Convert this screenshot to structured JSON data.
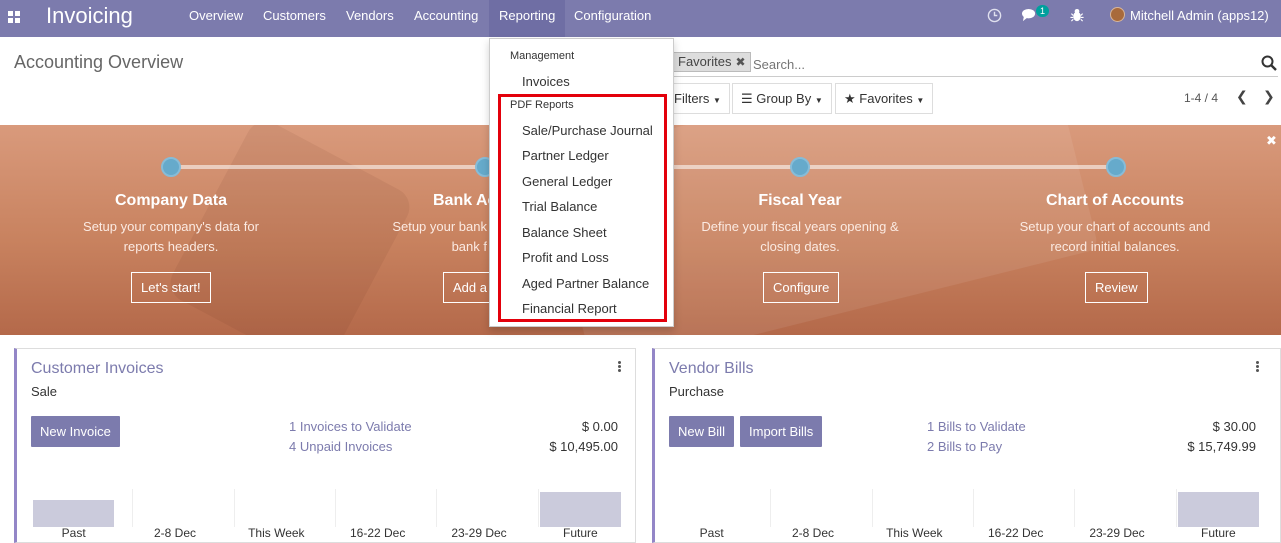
{
  "navbar": {
    "app_name": "Invoicing",
    "menus": [
      "Overview",
      "Customers",
      "Vendors",
      "Accounting",
      "Reporting",
      "Configuration"
    ],
    "active_menu": "Reporting",
    "messages_badge": "1",
    "user": "Mitchell Admin (apps12)"
  },
  "control_panel": {
    "title": "Accounting Overview",
    "facet": "Favorites",
    "search_placeholder": "Search...",
    "filters": "Filters",
    "group_by": "Group By",
    "favorites": "Favorites",
    "pager": "1-4 / 4"
  },
  "dropdown": {
    "section_management": "Management",
    "management_items": [
      "Invoices"
    ],
    "section_pdf": "PDF Reports",
    "pdf_items": [
      "Sale/Purchase Journal",
      "Partner Ledger",
      "General Ledger",
      "Trial Balance",
      "Balance Sheet",
      "Profit and Loss",
      "Aged Partner Balance",
      "Financial Report"
    ]
  },
  "onboarding": {
    "steps": [
      {
        "title": "Company Data",
        "desc1": "Setup your company's data for",
        "desc2": "reports headers.",
        "button": "Let's start!"
      },
      {
        "title": "Bank Ac",
        "desc1": "Setup your bank",
        "desc2": "bank f",
        "button": "Add a"
      },
      {
        "title": "Fiscal Year",
        "desc1": "Define your fiscal years opening &",
        "desc2": "closing dates.",
        "button": "Configure"
      },
      {
        "title": "Chart of Accounts",
        "desc1": "Setup your chart of accounts and",
        "desc2": "record initial balances.",
        "button": "Review"
      }
    ]
  },
  "cards": [
    {
      "title": "Customer Invoices",
      "subtitle": "Sale",
      "buttons": [
        "New Invoice"
      ],
      "link1": "1 Invoices to Validate",
      "amount1": "$ 0.00",
      "link2": "4 Unpaid Invoices",
      "amount2": "$ 10,495.00",
      "graph_labels": [
        "Past",
        "2-8 Dec",
        "This Week",
        "16-22 Dec",
        "23-29 Dec",
        "Future"
      ],
      "graph_values": [
        0.72,
        0,
        0,
        0,
        0,
        0.92
      ]
    },
    {
      "title": "Vendor Bills",
      "subtitle": "Purchase",
      "buttons": [
        "New Bill",
        "Import Bills"
      ],
      "link1": "1 Bills to Validate",
      "amount1": "$ 30.00",
      "link2": "2 Bills to Pay",
      "amount2": "$ 15,749.99",
      "graph_labels": [
        "Past",
        "2-8 Dec",
        "This Week",
        "16-22 Dec",
        "23-29 Dec",
        "Future"
      ],
      "graph_values": [
        0,
        0,
        0,
        0,
        0,
        0.92
      ]
    }
  ],
  "colors": {
    "navbar": "#7c7bad",
    "accent": "#7c7bad",
    "highlight": "#e3000b",
    "banner": "#c8825f"
  }
}
